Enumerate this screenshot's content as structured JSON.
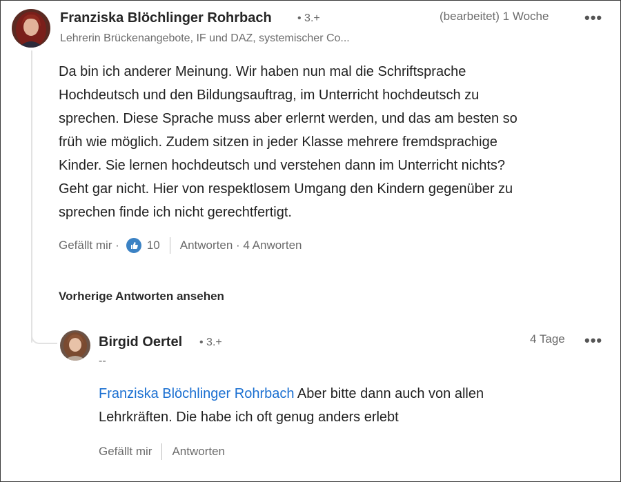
{
  "comment": {
    "author": "Franziska Blöchlinger Rohrbach",
    "degree": "• 3.+",
    "headline": "Lehrerin Brückenangebote, IF und DAZ, systemischer Co...",
    "edited_time": "(bearbeitet) 1 Woche",
    "more": "•••",
    "text_lines": [
      "Da bin ich anderer Meinung. Wir haben nun mal die Schriftsprache",
      "Hochdeutsch und den Bildungsauftrag, im Unterricht hochdeutsch zu",
      "sprechen. Diese Sprache muss aber erlernt werden, und das am besten so",
      "früh wie möglich. Zudem sitzen in jeder Klasse mehrere fremdsprachige",
      "Kinder. Sie lernen hochdeutsch und verstehen dann im Unterricht nichts?",
      "Geht gar nicht. Hier von respektlosem Umgang den Kindern gegenüber zu",
      "sprechen finde ich nicht gerechtfertigt."
    ],
    "like_label": "Gefällt mir ·",
    "like_count": "10",
    "reply_label": "Antworten · 4 Anworten",
    "like_color": "#3b82c4"
  },
  "previous_replies_label": "Vorherige Antworten ansehen",
  "reply": {
    "author": "Birgid Oertel",
    "degree": "• 3.+",
    "headline": "--",
    "time": "4 Tage",
    "more": "•••",
    "mention": "Franziska Blöchlinger Rohrbach",
    "text_first": " Aber bitte dann auch von allen",
    "text_second": "Lehrkräften. Die habe ich oft genug anders erlebt",
    "like_label": "Gefällt mir",
    "reply_label": "Antworten",
    "mention_color": "#1a6fd1"
  }
}
